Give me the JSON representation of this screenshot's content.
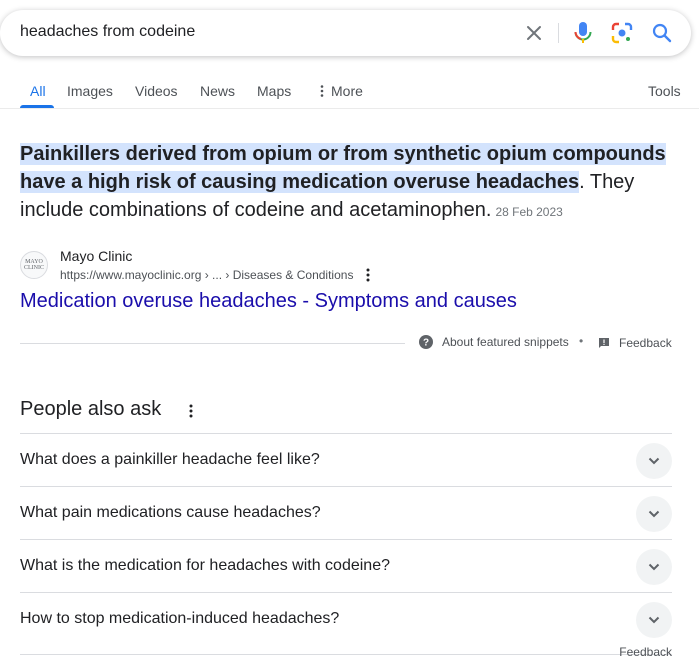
{
  "search": {
    "query": "headaches from codeine"
  },
  "tabs": [
    {
      "label": "All",
      "active": true
    },
    {
      "label": "Images"
    },
    {
      "label": "Videos"
    },
    {
      "label": "News"
    },
    {
      "label": "Maps"
    },
    {
      "label": "More"
    }
  ],
  "tools_label": "Tools",
  "snippet": {
    "highlight": "Painkillers derived from opium or from synthetic opium compounds have a high risk of causing medication overuse headaches",
    "rest": ". They include combinations of codeine and acetaminophen.",
    "date": "28 Feb 2023",
    "source": {
      "favicon_text": "MAYO CLINIC",
      "name": "Mayo Clinic",
      "url": "https://www.mayoclinic.org › ... › Diseases & Conditions"
    },
    "title": "Medication overuse headaches - Symptoms and causes",
    "about_label": "About featured snippets",
    "separator": "•",
    "feedback_label": "Feedback"
  },
  "paa": {
    "title": "People also ask",
    "questions": [
      "What does a painkiller headache feel like?",
      "What pain medications cause headaches?",
      "What is the medication for headaches with codeine?",
      "How to stop medication-induced headaches?"
    ],
    "feedback_label": "Feedback"
  },
  "colors": {
    "accent": "#1a73e8",
    "link": "#1a0dab",
    "highlight": "#d3e3fd"
  }
}
